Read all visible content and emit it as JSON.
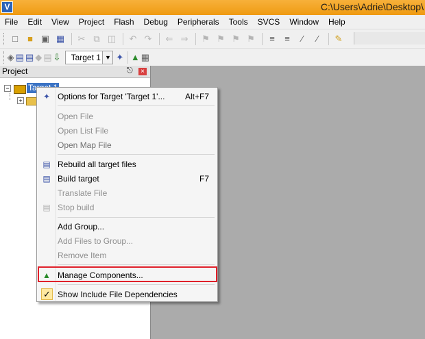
{
  "window": {
    "title": "C:\\Users\\Adrie\\Desktop\\"
  },
  "menubar": [
    "File",
    "Edit",
    "View",
    "Project",
    "Flash",
    "Debug",
    "Peripherals",
    "Tools",
    "SVCS",
    "Window",
    "Help"
  ],
  "toolbar2": {
    "target_value": "Target 1"
  },
  "project_panel": {
    "title": "Project",
    "tree": {
      "root_label": "Target 1"
    }
  },
  "context_menu": {
    "items": [
      {
        "label": "Options for Target 'Target 1'...",
        "shortcut": "Alt+F7",
        "enabled": true,
        "icon": "magic-wand-icon"
      },
      {
        "label": "Open File",
        "enabled": false
      },
      {
        "label": "Open List File",
        "enabled": false
      },
      {
        "label": "Open Map File",
        "enabled": false
      },
      {
        "label": "Rebuild all target files",
        "enabled": true,
        "icon": "rebuild-icon"
      },
      {
        "label": "Build target",
        "shortcut": "F7",
        "enabled": true,
        "icon": "build-icon"
      },
      {
        "label": "Translate File",
        "enabled": false
      },
      {
        "label": "Stop build",
        "enabled": false,
        "icon": "stop-build-icon"
      },
      {
        "label": "Add Group...",
        "enabled": true
      },
      {
        "label": "Add Files to Group...",
        "enabled": false
      },
      {
        "label": "Remove Item",
        "enabled": false
      },
      {
        "label": "Manage Components...",
        "enabled": true,
        "icon": "manage-components-icon"
      },
      {
        "label": "Show Include File Dependencies",
        "enabled": true,
        "checked": true
      }
    ]
  },
  "colors": {
    "title_bar": "#f5a623",
    "selection": "#3b73c4",
    "highlight_border": "#e0202a",
    "workspace": "#ababab"
  }
}
